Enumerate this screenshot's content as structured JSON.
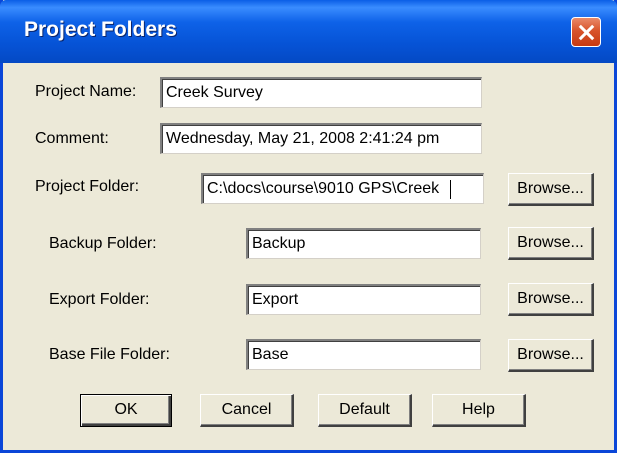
{
  "window": {
    "title": "Project Folders"
  },
  "form": {
    "project_name_label": "Project Name:",
    "project_name_value": "Creek Survey",
    "comment_label": "Comment:",
    "comment_value": "Wednesday, May 21, 2008 2:41:24 pm",
    "project_folder_label": "Project Folder:",
    "project_folder_value": "C:\\docs\\course\\9010 GPS\\Creek",
    "backup_folder_label": "Backup Folder:",
    "backup_folder_value": "Backup",
    "export_folder_label": "Export Folder:",
    "export_folder_value": "Export",
    "base_file_folder_label": "Base File Folder:",
    "base_file_folder_value": "Base"
  },
  "buttons": {
    "browse": "Browse...",
    "ok": "OK",
    "cancel": "Cancel",
    "default": "Default",
    "help": "Help"
  },
  "icons": {
    "close": "close-icon"
  },
  "colors": {
    "titlebar": "#0653d6",
    "close_button": "#d8542c",
    "dialog_background": "#ece9d8"
  }
}
